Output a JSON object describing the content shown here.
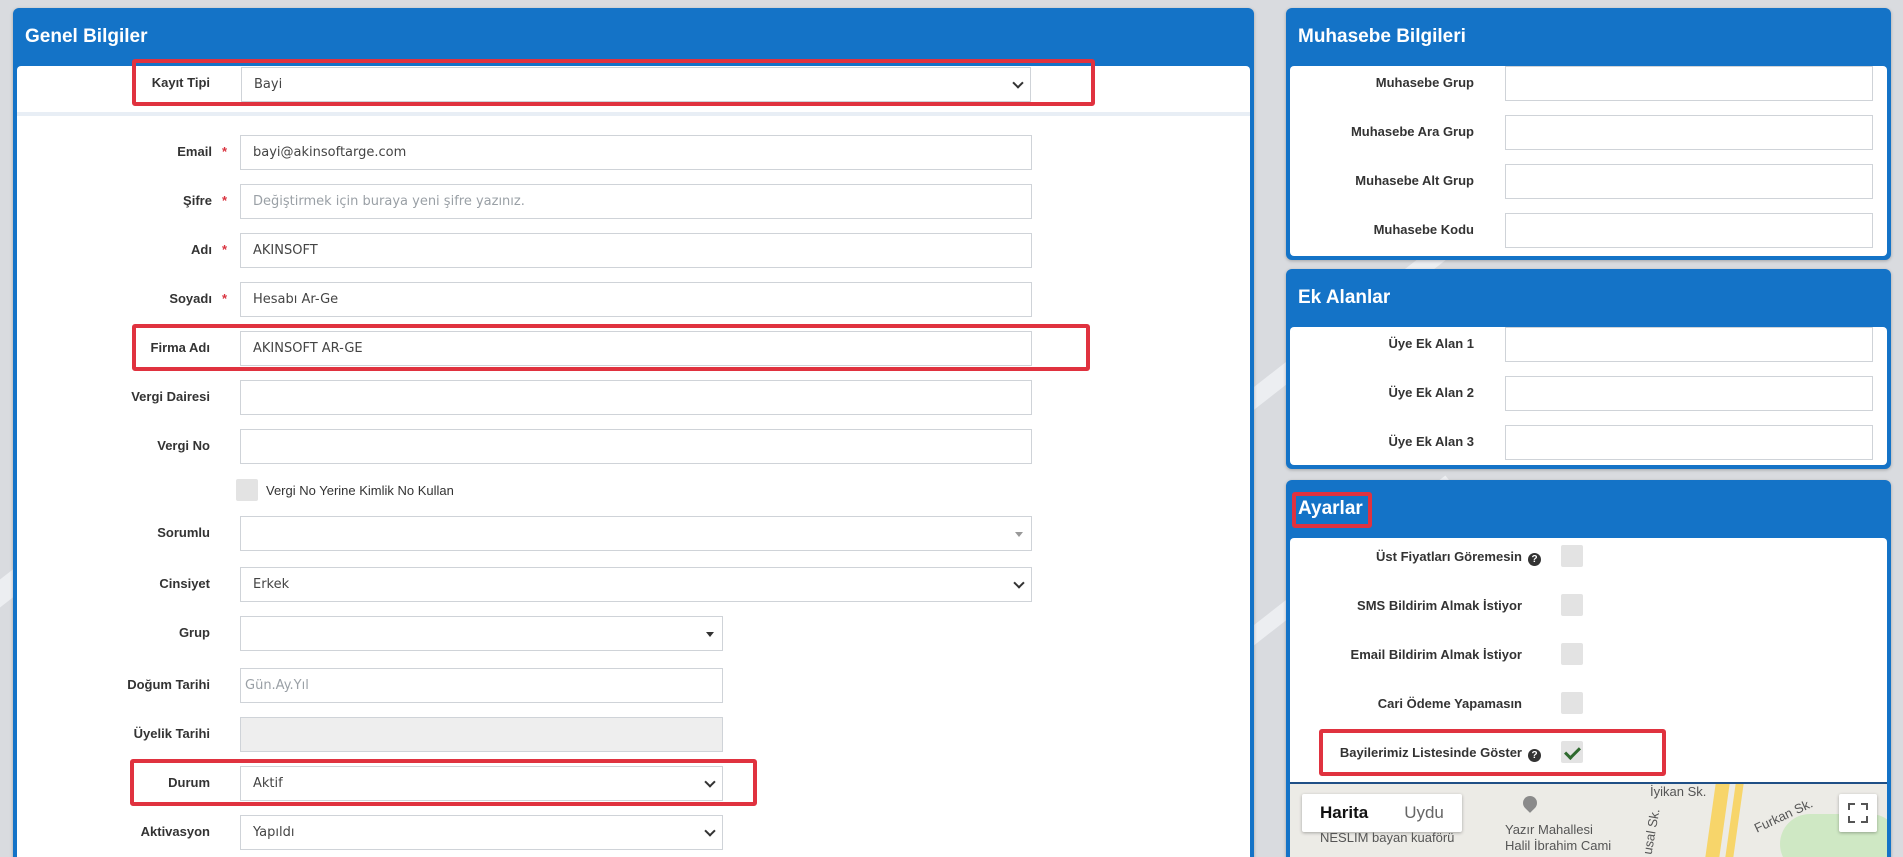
{
  "general_panel": {
    "title": "Genel Bilgiler",
    "record_type": {
      "label": "Kayıt Tipi",
      "value": "Bayi"
    },
    "email": {
      "label": "Email",
      "value": "bayi@akinsoftarge.com"
    },
    "password": {
      "label": "Şifre",
      "placeholder": "Değiştirmek için buraya yeni şifre yazınız."
    },
    "first_name": {
      "label": "Adı",
      "value": "AKINSOFT"
    },
    "last_name": {
      "label": "Soyadı",
      "value": "Hesabı Ar-Ge"
    },
    "company": {
      "label": "Firma Adı",
      "value": "AKINSOFT AR-GE"
    },
    "tax_office": {
      "label": "Vergi Dairesi",
      "value": ""
    },
    "tax_no": {
      "label": "Vergi No",
      "value": ""
    },
    "use_id_no": {
      "label": "Vergi No Yerine Kimlik No Kullan",
      "checked": false
    },
    "responsible": {
      "label": "Sorumlu",
      "value": ""
    },
    "gender": {
      "label": "Cinsiyet",
      "value": "Erkek"
    },
    "group": {
      "label": "Grup",
      "value": ""
    },
    "birth_date": {
      "label": "Doğum Tarihi",
      "placeholder": "Gün.Ay.Yıl"
    },
    "member_date": {
      "label": "Üyelik Tarihi",
      "value": ""
    },
    "status": {
      "label": "Durum",
      "value": "Aktif"
    },
    "activation": {
      "label": "Aktivasyon",
      "value": "Yapıldı"
    },
    "required_mark": "*"
  },
  "accounting_panel": {
    "title": "Muhasebe Bilgileri",
    "fields": [
      {
        "label": "Muhasebe Grup",
        "value": ""
      },
      {
        "label": "Muhasebe Ara Grup",
        "value": ""
      },
      {
        "label": "Muhasebe Alt Grup",
        "value": ""
      },
      {
        "label": "Muhasebe Kodu",
        "value": ""
      }
    ]
  },
  "extra_panel": {
    "title": "Ek Alanlar",
    "fields": [
      {
        "label": "Üye Ek Alan 1",
        "value": ""
      },
      {
        "label": "Üye Ek Alan 2",
        "value": ""
      },
      {
        "label": "Üye Ek Alan 3",
        "value": ""
      }
    ]
  },
  "settings_panel": {
    "title": "Ayarlar",
    "options": [
      {
        "label": "Üst Fiyatları Göremesin",
        "help": true,
        "checked": false
      },
      {
        "label": "SMS Bildirim Almak İstiyor",
        "help": false,
        "checked": false
      },
      {
        "label": "Email Bildirim Almak İstiyor",
        "help": false,
        "checked": false
      },
      {
        "label": "Cari Ödeme Yapamasın",
        "help": false,
        "checked": false
      },
      {
        "label": "Bayilerimiz Listesinde Göster",
        "help": true,
        "checked": true
      }
    ],
    "help_glyph": "?"
  },
  "map": {
    "tab_map": "Harita",
    "tab_satellite": "Uydu",
    "labels": [
      "NESLIM bayan kuaförü",
      "Yazır Mahallesi",
      "Halil İbrahim Cami",
      "İyikan Sk.",
      "Furkan Sk.",
      "usal Sk."
    ],
    "pin_icon": "map-pin-icon",
    "fullscreen_icon": "fullscreen-icon"
  },
  "colors": {
    "panel_blue": "#1473c7",
    "highlight_red": "#e0323f",
    "required_red": "#d9333f"
  }
}
